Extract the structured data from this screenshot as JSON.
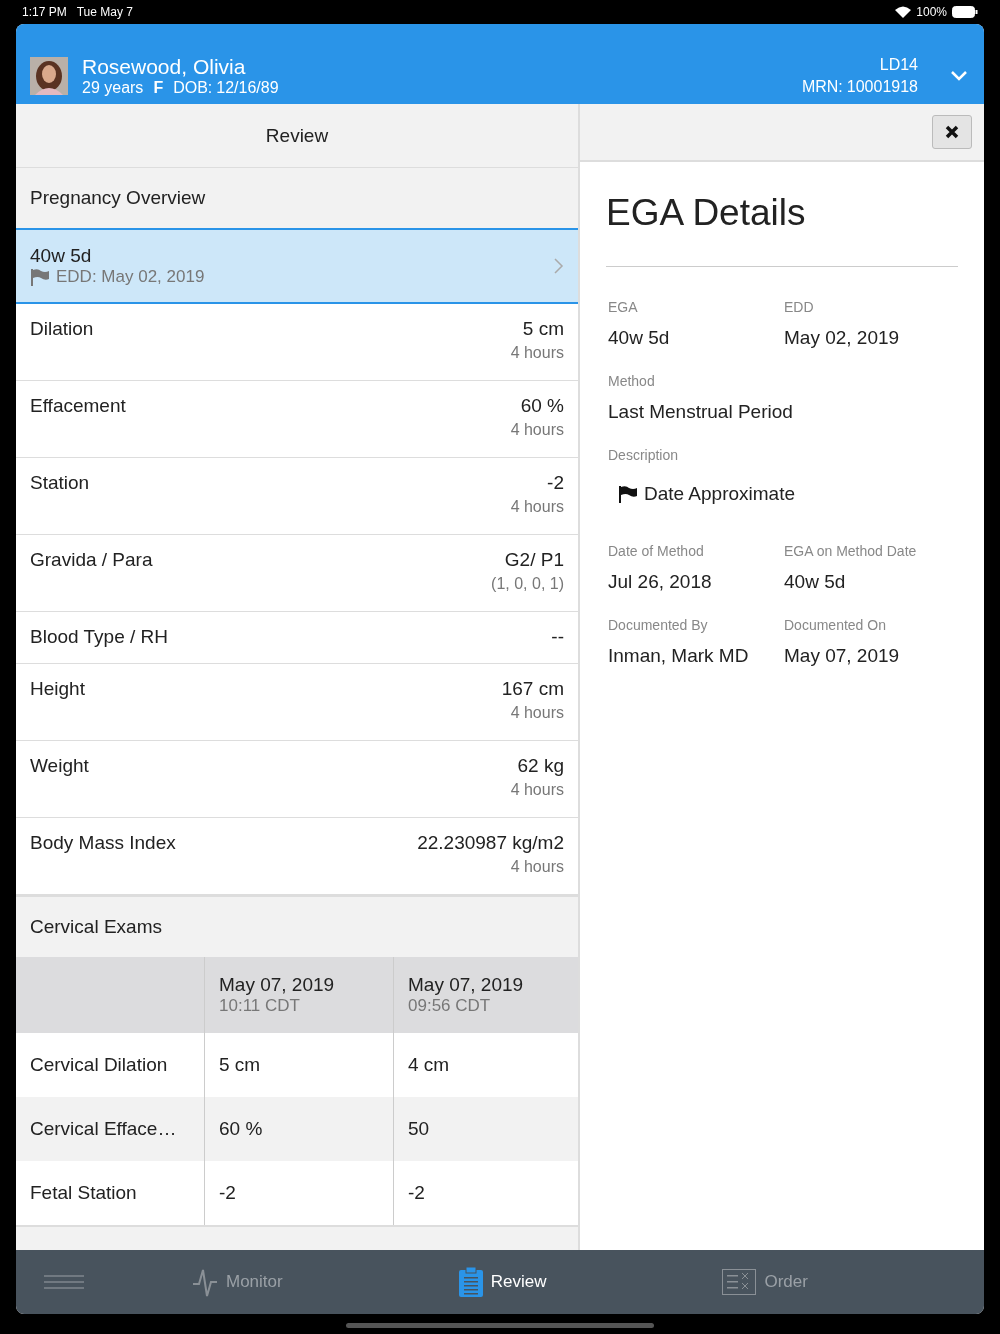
{
  "status_bar": {
    "time": "1:17 PM",
    "date": "Tue May 7",
    "battery": "100%"
  },
  "patient": {
    "name": "Rosewood, Olivia",
    "age": "29 years",
    "sex": "F",
    "dob_label": "DOB:",
    "dob": "12/16/89",
    "room": "LD14",
    "mrn_label": "MRN:",
    "mrn": "10001918"
  },
  "review": {
    "title": "Review",
    "overview": {
      "title": "Pregnancy Overview",
      "ega": "40w 5d",
      "edd": "EDD: May 02, 2019",
      "selected": true
    },
    "rows": [
      {
        "label": "Dilation",
        "value": "5 cm",
        "sub": "4 hours"
      },
      {
        "label": "Effacement",
        "value": "60 %",
        "sub": "4 hours"
      },
      {
        "label": "Station",
        "value": "-2",
        "sub": "4 hours"
      },
      {
        "label": "Gravida / Para",
        "value": "G2/ P1",
        "sub": "(1, 0, 0, 1)"
      },
      {
        "label": "Blood Type / RH",
        "value": "--"
      },
      {
        "label": "Height",
        "value": "167 cm",
        "sub": "4 hours"
      },
      {
        "label": "Weight",
        "value": "62 kg",
        "sub": "4 hours"
      },
      {
        "label": "Body Mass Index",
        "value": "22.230987 kg/m2",
        "sub": "4 hours"
      }
    ],
    "cervical": {
      "title": "Cervical Exams",
      "columns": [
        {
          "date": "May 07, 2019",
          "time": "10:11 CDT"
        },
        {
          "date": "May 07, 2019",
          "time": "09:56 CDT"
        }
      ],
      "rows": [
        {
          "label": "Cervical Dilation",
          "values": [
            "5 cm",
            "4 cm"
          ]
        },
        {
          "label": "Cervical Efface…",
          "values": [
            "60 %",
            "50"
          ]
        },
        {
          "label": "Fetal Station",
          "values": [
            "-2",
            "-2"
          ]
        }
      ]
    }
  },
  "details": {
    "title": "EGA Details",
    "fields": [
      {
        "label": "EGA",
        "value": "40w 5d"
      },
      {
        "label": "EDD",
        "value": "May 02, 2019"
      },
      {
        "label": "Method",
        "value": "Last Menstrual Period",
        "wide": true
      },
      {
        "label": "Description",
        "value": "Date Approximate",
        "wide": true,
        "flag": true
      },
      {
        "label": "Date of Method",
        "value": "Jul 26, 2018"
      },
      {
        "label": "EGA on Method Date",
        "value": "40w 5d"
      },
      {
        "label": "Documented By",
        "value": "Inman, Mark MD"
      },
      {
        "label": "Documented On",
        "value": "May 07, 2019"
      }
    ]
  },
  "tabs": [
    {
      "kind": "menu",
      "selected": false
    },
    {
      "kind": "monitor",
      "label": "Monitor",
      "selected": false
    },
    {
      "kind": "review",
      "label": "Review",
      "selected": true
    },
    {
      "kind": "order",
      "label": "Order",
      "selected": false
    }
  ]
}
